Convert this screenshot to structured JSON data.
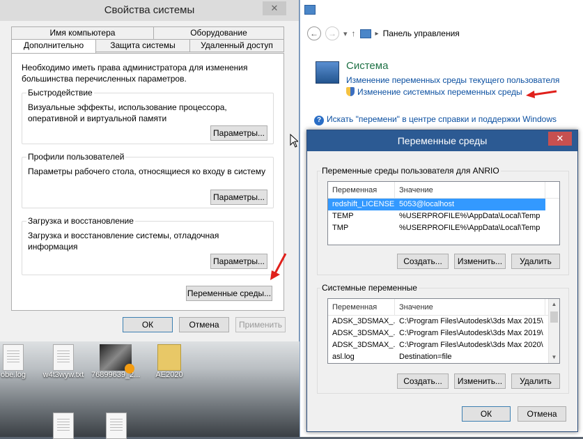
{
  "system_properties": {
    "title": "Свойства системы",
    "close_glyph": "✕",
    "tabs_top": [
      "Имя компьютера",
      "Оборудование"
    ],
    "tabs_bottom": [
      "Дополнительно",
      "Защита системы",
      "Удаленный доступ"
    ],
    "admin_note": "Необходимо иметь права администратора для изменения большинства перечисленных параметров.",
    "performance": {
      "title": "Быстродействие",
      "desc": "Визуальные эффекты, использование процессора, оперативной и виртуальной памяти",
      "button": "Параметры..."
    },
    "profiles": {
      "title": "Профили пользователей",
      "desc": "Параметры рабочего стола, относящиеся ко входу в систему",
      "button": "Параметры..."
    },
    "startup": {
      "title": "Загрузка и восстановление",
      "desc": "Загрузка и восстановление системы, отладочная информация",
      "button": "Параметры..."
    },
    "env_button": "Переменные среды...",
    "ok": "ОК",
    "cancel": "Отмена",
    "apply": "Применить"
  },
  "desktop": {
    "icons": [
      {
        "label": "obe.log",
        "icon": "document-icon"
      },
      {
        "label": "w4t3wyw.txt",
        "icon": "document-icon"
      },
      {
        "label": "76899639_2...",
        "icon": "video-thumbnail-icon"
      },
      {
        "label": "AE2020",
        "icon": "folder-icon"
      }
    ]
  },
  "control_panel": {
    "breadcrumb": "Панель управления",
    "breadcrumb_sep": "▸",
    "section_title": "Система",
    "link_user_env": "Изменение переменных среды текущего пользователя",
    "link_system_env": "Изменение системных переменных среды",
    "help_link": "Искать \"перемени\" в центре справки и поддержки Windows",
    "back_glyph": "←",
    "forward_glyph": "→",
    "dropdown_glyph": "▾",
    "up_glyph": "↑",
    "help_glyph": "?"
  },
  "env_dialog": {
    "title": "Переменные среды",
    "close_glyph": "✕",
    "user_group_title": "Переменные среды пользователя для ANRIO",
    "system_group_title": "Системные переменные",
    "col_variable": "Переменная",
    "col_value": "Значение",
    "user_vars": [
      {
        "name": "redshift_LICENSE",
        "value": "5053@localhost"
      },
      {
        "name": "TEMP",
        "value": "%USERPROFILE%\\AppData\\Local\\Temp"
      },
      {
        "name": "TMP",
        "value": "%USERPROFILE%\\AppData\\Local\\Temp"
      }
    ],
    "system_vars": [
      {
        "name": "ADSK_3DSMAX_...",
        "value": "C:\\Program Files\\Autodesk\\3ds Max 2015\\"
      },
      {
        "name": "ADSK_3DSMAX_...",
        "value": "C:\\Program Files\\Autodesk\\3ds Max 2019\\"
      },
      {
        "name": "ADSK_3DSMAX_...",
        "value": "C:\\Program Files\\Autodesk\\3ds Max 2020\\"
      },
      {
        "name": "asl.log",
        "value": "Destination=file"
      }
    ],
    "create": "Создать...",
    "edit": "Изменить...",
    "delete": "Удалить",
    "ok": "ОК",
    "cancel": "Отмена"
  },
  "colors": {
    "accent_red": "#e0201b",
    "selection_blue": "#3399ff",
    "dialog_title_blue": "#2c5a93"
  }
}
